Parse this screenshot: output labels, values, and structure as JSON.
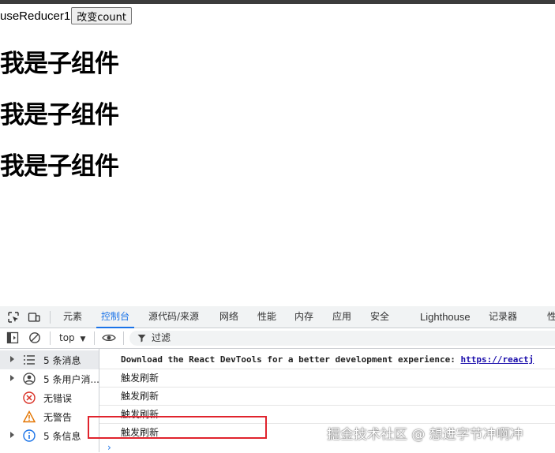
{
  "page": {
    "reducer_text": "useReducer1",
    "button_label": "改变count",
    "children": [
      "我是子组件",
      "我是子组件",
      "我是子组件"
    ]
  },
  "devtools": {
    "tabs": [
      "元素",
      "控制台",
      "源代码/来源",
      "网络",
      "性能",
      "内存",
      "应用",
      "安全",
      "Lighthouse",
      "记录器",
      "性"
    ],
    "active_tab": "控制台",
    "context": "top",
    "filter_placeholder": "过滤",
    "sidebar": [
      {
        "label": "5 条消息",
        "icon": "list-icon"
      },
      {
        "label": "5 条用户消...",
        "icon": "user-icon"
      },
      {
        "label": "无错误",
        "icon": "error-icon"
      },
      {
        "label": "无警告",
        "icon": "warning-icon"
      },
      {
        "label": "5 条信息",
        "icon": "info-icon"
      }
    ],
    "logs": {
      "first_text": "Download the React DevTools for a better development experience: ",
      "first_link": "https://reactj",
      "rows": [
        "触发刷新",
        "触发刷新",
        "触发刷新",
        "触发刷新"
      ]
    },
    "colors": {
      "accent": "#1a73e8",
      "highlight": "#e0232d"
    }
  },
  "watermark": "掘金技术社区 @ 想进字节冲啊冲"
}
